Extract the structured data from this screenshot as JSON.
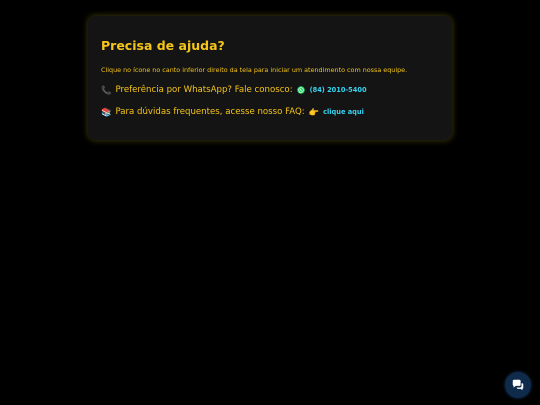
{
  "help": {
    "title": "Precisa de ajuda?",
    "description": "Clique no ícone no canto inferior direito da tela para iniciar um atendimento com nossa equipe.",
    "whatsapp": {
      "emoji": "📞",
      "text": "Preferência por WhatsApp? Fale conosco:",
      "icon": "whatsapp-icon",
      "phone": "(84) 2010-5400"
    },
    "faq": {
      "emoji": "📚",
      "text": "Para dúvidas frequentes, acesse nosso FAQ:",
      "pointer": "👉",
      "link_label": "clique aqui"
    }
  },
  "chat_widget": {
    "icon": "chat-bubble-icon"
  },
  "colors": {
    "background": "#000000",
    "card": "#141414",
    "accent": "#f5c518",
    "link": "#34d3f0",
    "chat_button": "#0f2b4c"
  }
}
